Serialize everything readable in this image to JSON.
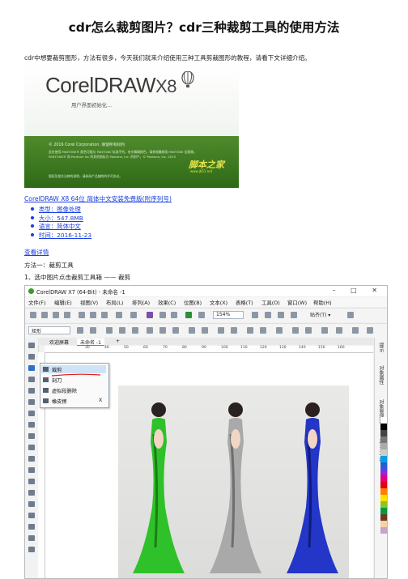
{
  "title": "cdr怎么裁剪图片？cdr三种裁剪工具的使用方法",
  "intro": "cdr中想要裁剪图形，方法有很多，今天我们就来介绍使用三种工具剪裁图形的教程，请看下文详细介绍。",
  "hero": {
    "logo": "CorelDRAW",
    "version": "X8",
    "init_text": "用户界面初始化...",
    "copyright": "© 2016 Corel Corporation. 保留所有权利",
    "fine_print": "此处使用 PANTONE® 颜色可能与 PANTONE 标准不符。有关精确颜色，请参阅最新版 PANTONE 出版物。PANTONE® 和 Pantone Inc 的其他商标为 Pantone, Inc. 的财产。© Pantone, Inc. 2015",
    "fine_print2": "版权及相关法律的说明，请参阅产品随附的许可协议。",
    "watermark": "脚本之家",
    "watermark_sub": "www.jb51.net"
  },
  "download_link": "CorelDRAW X8 64位 简体中文安装免费版(附序列号)",
  "details": [
    "类型：图像处理",
    "大小：547.8MB",
    "语言：简体中文",
    "时间：2016-11-23"
  ],
  "more_link": "查看详情",
  "method": "方法一：裁剪工具",
  "step": "1、选中图片点击裁剪工具箱 —— 裁剪",
  "app": {
    "window_title": "CorelDRAW X7 (64-Bit) - 未命名 -1",
    "window_buttons": "– □ ✕",
    "menu": [
      "文件(F)",
      "编辑(E)",
      "视图(V)",
      "布局(L)",
      "排列(A)",
      "效果(C)",
      "位图(B)",
      "文本(X)",
      "表格(T)",
      "工具(O)",
      "窗口(W)",
      "帮助(H)"
    ],
    "zoom": "154%",
    "snap": "贴齐(T) ▾",
    "shape_select": "矩形",
    "tabs": [
      "欢迎屏幕",
      "未命名 -1"
    ],
    "ruler_ticks": [
      "30",
      "40",
      "50",
      "60",
      "70",
      "80",
      "90",
      "100",
      "110",
      "120",
      "130",
      "140",
      "150",
      "160"
    ],
    "flyout": [
      {
        "label": "裁剪",
        "key": ""
      },
      {
        "label": "刻刀",
        "key": ""
      },
      {
        "label": "虚拟段删除",
        "key": ""
      },
      {
        "label": "橡皮擦",
        "key": "X"
      }
    ],
    "docker_labels": [
      "提示",
      "对象属性",
      "对象管理器",
      "对齐与分布"
    ],
    "palette": [
      "#ffffff",
      "#000000",
      "#444444",
      "#777777",
      "#aaaaaa",
      "#cccccc",
      "#00a0e9",
      "#2a5bd7",
      "#8f2bd1",
      "#e4007f",
      "#e60012",
      "#ff7f00",
      "#ffe100",
      "#8fc31f",
      "#009944",
      "#6b3a1f",
      "#f5d0a9",
      "#c8a2c8"
    ],
    "accent": "#2f8fd8"
  }
}
